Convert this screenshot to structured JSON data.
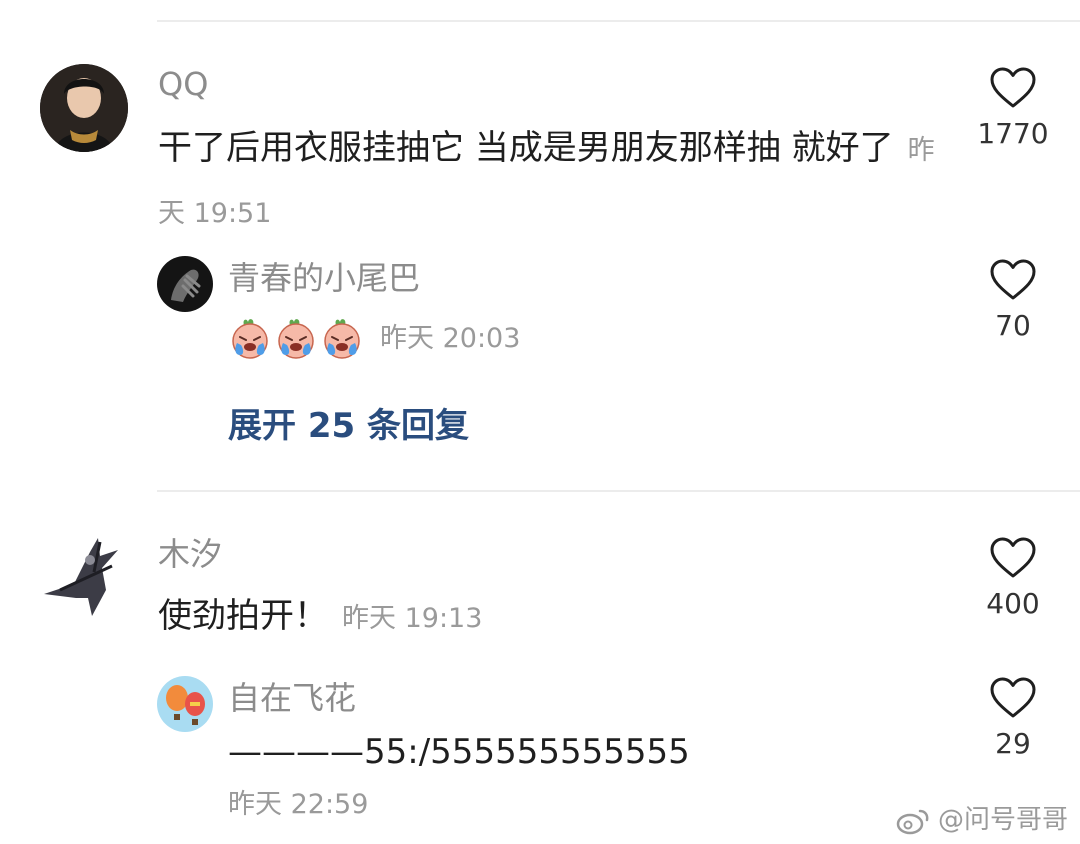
{
  "comments": [
    {
      "user": "QQ",
      "text": "干了后用衣服挂抽它 当成是男朋友那样抽 就好了",
      "time": "昨天 19:51",
      "likes": "1770",
      "reply": {
        "user": "青春的小尾巴",
        "emoji_icons": [
          "crying-face-emoji",
          "crying-face-emoji",
          "crying-face-emoji"
        ],
        "time": "昨天 20:03",
        "likes": "70"
      },
      "expand_label": "展开 25 条回复"
    },
    {
      "user": "木汐",
      "text": "使劲拍开！",
      "time": "昨天 19:13",
      "likes": "400",
      "reply": {
        "user": "自在飞花",
        "text": "————55:/555555555555",
        "time": "昨天 22:59",
        "likes": "29"
      }
    }
  ],
  "icons": {
    "like": "heart-outline-icon",
    "watermark_logo": "weibo-logo-icon"
  },
  "watermark": "@问号哥哥",
  "colors": {
    "link": "#2a4d7e",
    "secondary_text": "#8c8c8c",
    "divider": "#ececec"
  }
}
